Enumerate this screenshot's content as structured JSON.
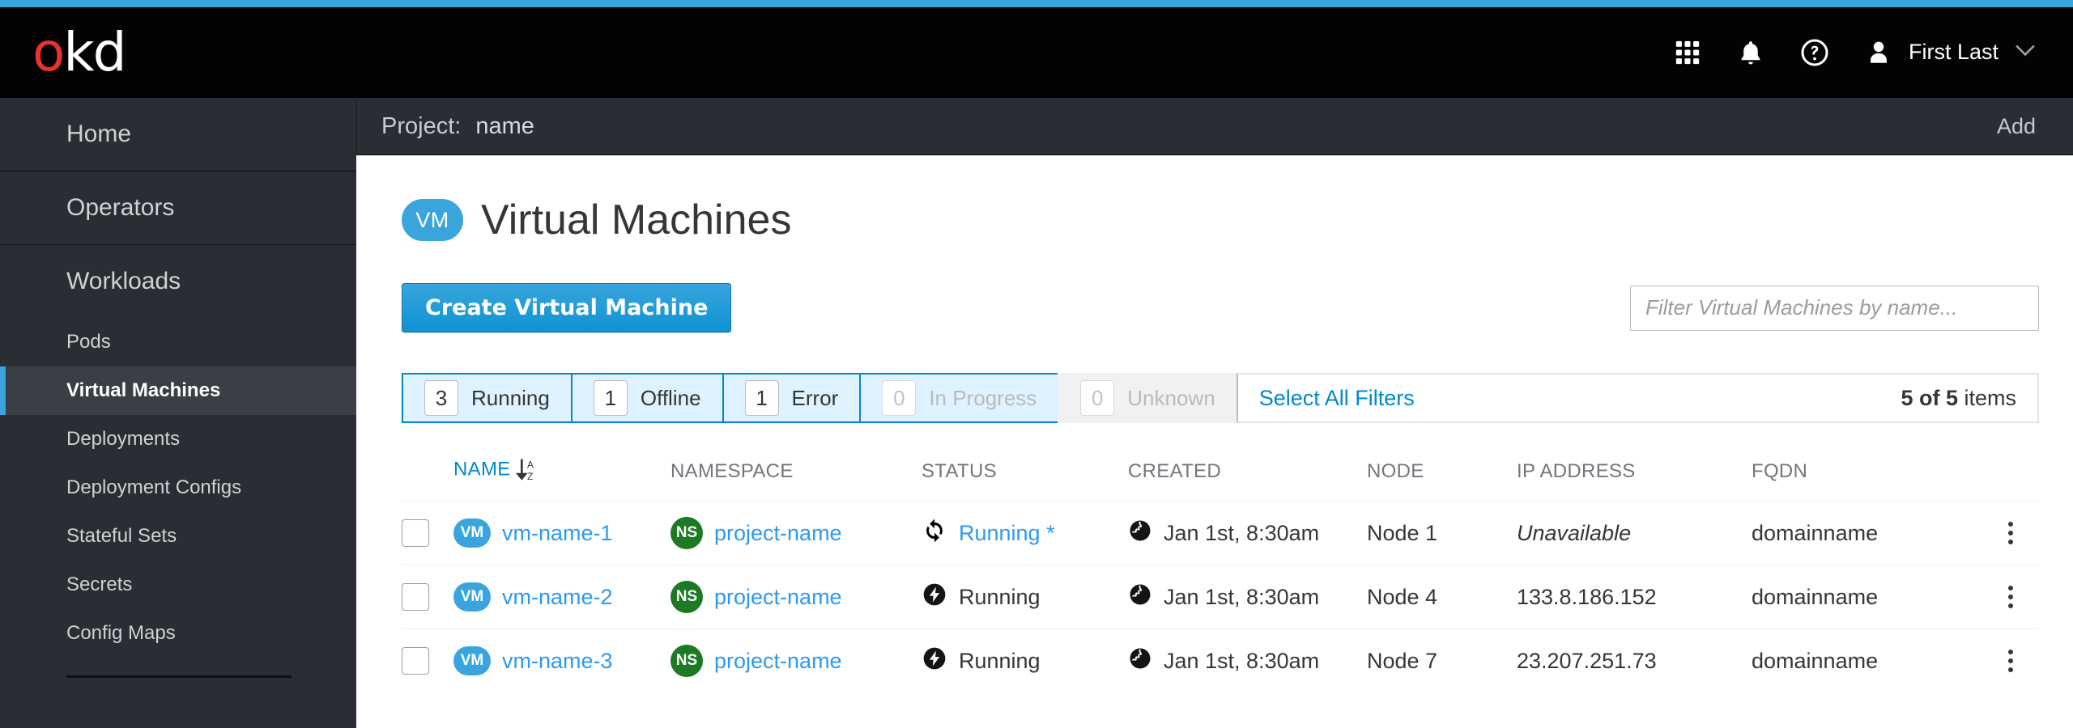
{
  "theme": {
    "accent_blue": "#39a5dc",
    "link_blue": "#0088ce",
    "row_link_blue": "#2b9af3",
    "masthead_bg": "#030303",
    "sidebar_bg": "#292e34",
    "logo_red": "#e8322c",
    "ns_green": "#1d7a24"
  },
  "masthead": {
    "logo": {
      "o": "o",
      "kd": "kd",
      "name": "okd-logo"
    },
    "icons": [
      {
        "name": "app-launcher-icon",
        "label": "Application launcher"
      },
      {
        "name": "bell-icon",
        "label": "Notifications"
      },
      {
        "name": "help-icon",
        "label": "Help"
      }
    ],
    "user": {
      "avatar": "user-avatar-icon",
      "name": "First Last",
      "caret": "chevron-down-icon"
    }
  },
  "sidebar": {
    "sections": [
      {
        "header": "Home",
        "items": []
      },
      {
        "header": "Operators",
        "items": []
      },
      {
        "header": "Workloads",
        "items": [
          {
            "label": "Pods",
            "active": false
          },
          {
            "label": "Virtual Machines",
            "active": true
          },
          {
            "label": "Deployments",
            "active": false
          },
          {
            "label": "Deployment Configs",
            "active": false
          },
          {
            "label": "Stateful Sets",
            "active": false
          },
          {
            "label": "Secrets",
            "active": false
          },
          {
            "label": "Config Maps",
            "active": false
          }
        ]
      }
    ]
  },
  "project_bar": {
    "label": "Project:",
    "value": "name",
    "add_label": "Add"
  },
  "page": {
    "badge": "VM",
    "title": "Virtual Machines"
  },
  "toolbar": {
    "create_label": "Create Virtual Machine",
    "filter_placeholder": "Filter Virtual Machines by name...",
    "filter_value": ""
  },
  "status_filters": {
    "chips": [
      {
        "count": "3",
        "label": "Running",
        "state": "on"
      },
      {
        "count": "1",
        "label": "Offline",
        "state": "on"
      },
      {
        "count": "1",
        "label": "Error",
        "state": "on"
      },
      {
        "count": "0",
        "label": "In Progress",
        "state": "on-disabled"
      },
      {
        "count": "0",
        "label": "Unknown",
        "state": "off-disabled"
      }
    ],
    "select_all_label": "Select All Filters",
    "items_count_bold": "5 of 5",
    "items_count_rest": " items"
  },
  "table": {
    "columns": [
      {
        "key": "name",
        "label": "NAME",
        "sorted": true
      },
      {
        "key": "ns",
        "label": "NAMESPACE",
        "sorted": false
      },
      {
        "key": "status",
        "label": "STATUS",
        "sorted": false
      },
      {
        "key": "created",
        "label": "CREATED",
        "sorted": false
      },
      {
        "key": "node",
        "label": "NODE",
        "sorted": false
      },
      {
        "key": "ip",
        "label": "IP ADDRESS",
        "sorted": false
      },
      {
        "key": "fqdn",
        "label": "FQDN",
        "sorted": false
      }
    ],
    "sort_icon": {
      "name": "sort-az-desc-icon",
      "top": "A",
      "bottom": "Z"
    },
    "rows": [
      {
        "name": "vm-name-1",
        "namespace": "project-name",
        "status_text": "Running *",
        "status_icon": "sync-icon",
        "status_style": "blue",
        "created": "Jan 1st, 8:30am",
        "node": "Node 1",
        "ip": "Unavailable",
        "ip_style": "muted-italic",
        "fqdn": "domainname"
      },
      {
        "name": "vm-name-2",
        "namespace": "project-name",
        "status_text": "Running",
        "status_icon": "power-on-icon",
        "status_style": "dark",
        "created": "Jan 1st, 8:30am",
        "node": "Node 4",
        "ip": "133.8.186.152",
        "ip_style": "",
        "fqdn": "domainname"
      },
      {
        "name": "vm-name-3",
        "namespace": "project-name",
        "status_text": "Running",
        "status_icon": "power-on-icon",
        "status_style": "dark",
        "created": "Jan 1st, 8:30am",
        "node": "Node 7",
        "ip": "23.207.251.73",
        "ip_style": "",
        "fqdn": "domainname"
      }
    ],
    "row_badges": {
      "vm": "VM",
      "ns": "NS"
    },
    "created_icon": "globe-icon",
    "kebab_icon": "kebab-menu-icon"
  }
}
